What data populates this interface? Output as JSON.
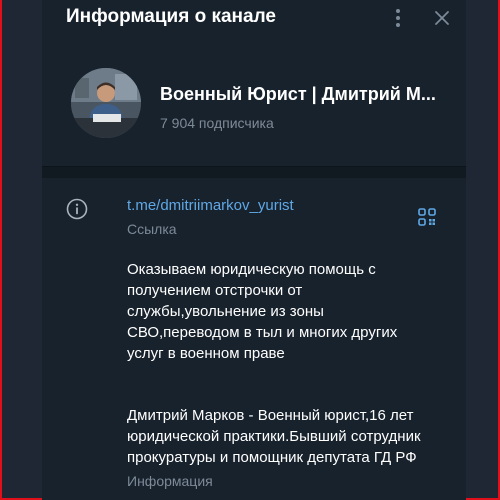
{
  "header": {
    "title": "Информация о канале",
    "more_icon": "more-vertical-icon",
    "close_icon": "close-icon"
  },
  "channel": {
    "name": "Военный Юрист | Дмитрий М...",
    "subscribers": "7 904 подписчика"
  },
  "link": {
    "url": "t.me/dmitriimarkov_yurist",
    "label": "Ссылка",
    "icon": "info-icon",
    "qr_icon": "qr-code-icon"
  },
  "description": "Оказываем юридическую помощь с получением отстрочки от службы,увольнение из зоны СВО,переводом в тыл и многих других услуг в военном праве",
  "bio": {
    "text": "Дмитрий Марков - Военный юрист,16 лет юридической практики.Бывший сотрудник прокуратуры и помощник депутата ГД РФ",
    "label": "Информация"
  },
  "colors": {
    "background": "#18222d",
    "accent": "#5fa8e6",
    "muted": "#7d8a97",
    "frame_border": "#e10f1a"
  }
}
